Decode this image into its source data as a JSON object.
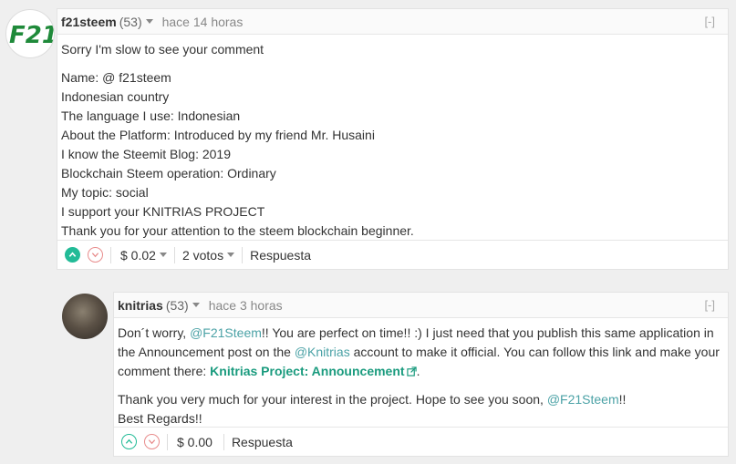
{
  "comment1": {
    "author": "f21steem",
    "reputation": "(53)",
    "time": "hace 14 horas",
    "collapse": "[-]",
    "avatar_text": "F21",
    "intro": "Sorry I'm slow to see your comment",
    "lines": [
      "Name: @ f21steem",
      "Indonesian country",
      "The language I use: Indonesian",
      "About the Platform: Introduced by my friend Mr. Husaini",
      "I know the Steemit Blog: 2019",
      "Blockchain Steem operation: Ordinary",
      "My topic: social",
      "I support your KNITRIAS PROJECT",
      "Thank you for your attention to the steem blockchain beginner."
    ],
    "payout": "$ 0.02",
    "votes": "2 votos",
    "reply": "Respuesta"
  },
  "comment2": {
    "author": "knitrias",
    "reputation": "(53)",
    "time": "hace 3 horas",
    "collapse": "[-]",
    "p1_a": "Don´t worry, ",
    "p1_mention": "@F21Steem",
    "p1_b": "!! You are perfect on time!! :) I just need that you publish this same application in the Announcement post on the ",
    "p1_mention2": "@Knitrias",
    "p1_c": " account to make it official. You can follow this link and make your comment there: ",
    "p1_link": "Knitrias Project: Announcement",
    "p1_d": ".",
    "p2_a": "Thank you very much for your interest in the project. Hope to see you soon, ",
    "p2_mention": "@F21Steem",
    "p2_b": "!!",
    "p3": "Best Regards!!",
    "payout": "$ 0.00",
    "reply": "Respuesta"
  },
  "icons": {
    "upvote": "chevron-up-icon",
    "downvote": "chevron-down-icon",
    "external": "external-link-icon"
  },
  "colors": {
    "upvote": "#22bb97",
    "downvote": "#e88c8c",
    "mention": "#4ba2a6",
    "link": "#1a9b7e"
  }
}
